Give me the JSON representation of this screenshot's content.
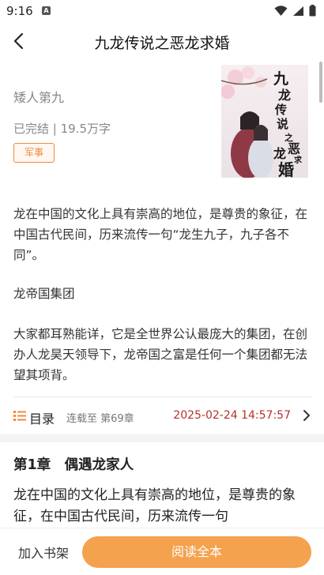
{
  "status_bar": {
    "time": "9:16",
    "notification_glyph": "A",
    "icons": [
      "wifi-icon",
      "signal-icon",
      "battery-icon"
    ]
  },
  "header": {
    "title": "九龙传说之恶龙求婚",
    "back_icon": "back-arrow-icon"
  },
  "book": {
    "author": "矮人第九",
    "meta": "已完结 | 19.5万字",
    "tag": "军事",
    "cover_title": "九龙传说之恶龙求婚"
  },
  "description": {
    "para1": "龙在中国的文化上具有崇高的地位，是尊贵的象征，在中国古代民间，历来流传一句“龙生九子，九子各不同”。",
    "para2": "龙帝国集团",
    "para3": "大家都耳熟能详，它是全世界公认最庞大的集团，在创办人龙昊天领导下，龙帝国之富是任何一个集团都无法望其项背。"
  },
  "catalog": {
    "label": "目录",
    "status": "连载至 第69章",
    "updated": "2025-02-24 14:57:57"
  },
  "chapter": {
    "title": "第1章　偶遇龙家人",
    "body": "龙在中国的文化上具有崇高的地位，是尊贵的象征，在中国古代民间，历来流传一句"
  },
  "bottom": {
    "add_shelf": "加入书架",
    "read_all": "阅读全本"
  },
  "colors": {
    "accent": "#f4a24e",
    "tag": "#f08a3c",
    "date": "#b5322e"
  }
}
